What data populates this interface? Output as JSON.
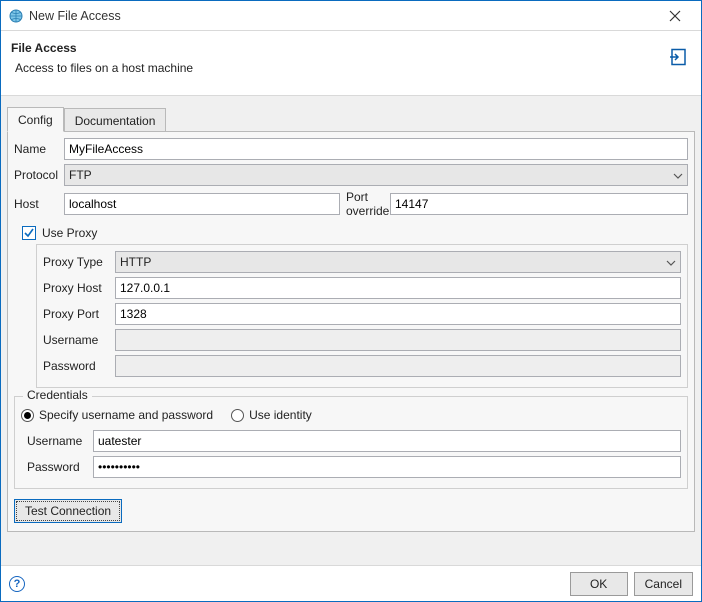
{
  "window": {
    "title": "New File Access"
  },
  "header": {
    "title": "File Access",
    "subtitle": "Access to files on a host machine"
  },
  "tabs": {
    "config": "Config",
    "documentation": "Documentation"
  },
  "form": {
    "name_label": "Name",
    "name_value": "MyFileAccess",
    "protocol_label": "Protocol",
    "protocol_value": "FTP",
    "host_label": "Host",
    "host_value": "localhost",
    "port_override_label": "Port override",
    "port_override_value": "14147",
    "use_proxy_label": "Use Proxy",
    "use_proxy_checked": true,
    "proxy": {
      "type_label": "Proxy Type",
      "type_value": "HTTP",
      "host_label": "Proxy Host",
      "host_value": "127.0.0.1",
      "port_label": "Proxy Port",
      "port_value": "1328",
      "username_label": "Username",
      "username_value": "",
      "password_label": "Password",
      "password_value": ""
    },
    "credentials": {
      "legend": "Credentials",
      "radio_specify": "Specify username and password",
      "radio_identity": "Use identity",
      "selected": "specify",
      "username_label": "Username",
      "username_value": "uatester",
      "password_label": "Password",
      "password_value": "••••••••••"
    },
    "test_connection": "Test Connection"
  },
  "footer": {
    "ok": "OK",
    "cancel": "Cancel",
    "help": "?"
  }
}
